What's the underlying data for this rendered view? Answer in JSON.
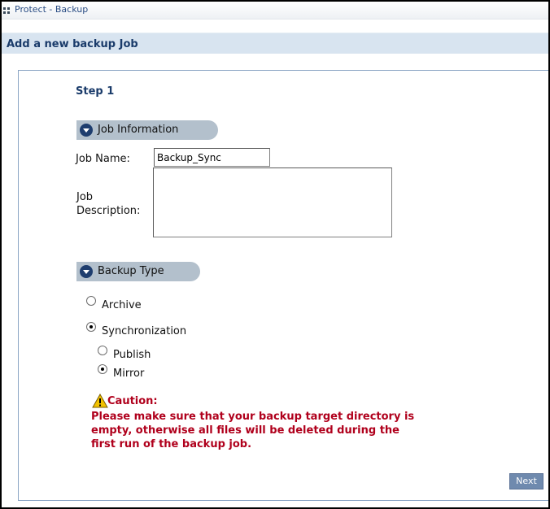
{
  "window": {
    "title": "Protect - Backup"
  },
  "page": {
    "title": "Add a new backup Job",
    "step": "Step 1"
  },
  "job_info": {
    "section_label": "Job Information",
    "name_label": "Job Name:",
    "name_value": "Backup_Sync",
    "description_label_line1": "Job",
    "description_label_line2": "Description:",
    "description_value": ""
  },
  "backup_type": {
    "section_label": "Backup Type",
    "archive_label": "Archive",
    "sync_label": "Synchronization",
    "publish_label": "Publish",
    "mirror_label": "Mirror",
    "selected": "Synchronization",
    "sync_mode": "Mirror"
  },
  "caution": {
    "title": "Caution:",
    "line1": "Please make sure that your backup target directory is",
    "line2": "empty, otherwise all files will be deleted during the",
    "line3": "first run of the backup job."
  },
  "actions": {
    "next_label": "Next"
  },
  "colors": {
    "accent": "#1a3b6a",
    "warning": "#b0001c",
    "button": "#6f8aae"
  },
  "icons": {
    "section": "circle-down-arrow-icon",
    "warning": "warning-triangle-icon",
    "window": "grip-icon"
  }
}
